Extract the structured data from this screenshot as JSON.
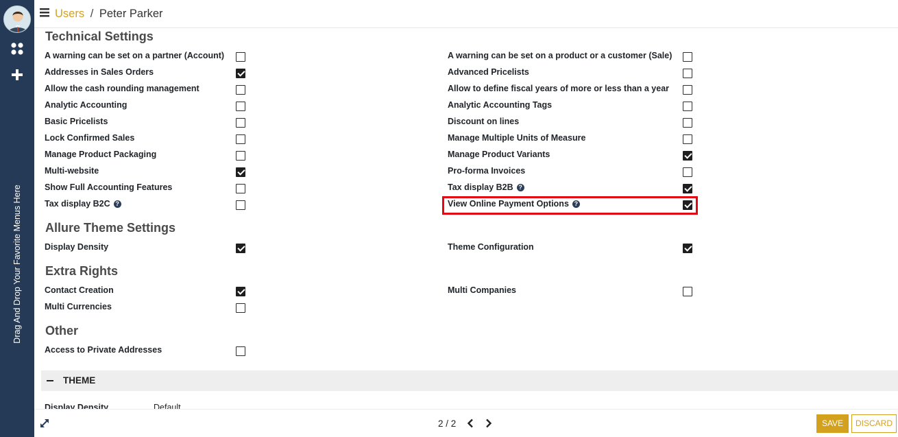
{
  "breadcrumb": {
    "parent": "Users",
    "separator": "/",
    "current": "Peter Parker"
  },
  "sidebar": {
    "favorite_hint": "Drag And Drop Your Favorite Menus Here"
  },
  "sections": {
    "technical": {
      "title": "Technical Settings",
      "left": [
        {
          "label": "A warning can be set on a partner (Account)",
          "checked": false
        },
        {
          "label": "Addresses in Sales Orders",
          "checked": true
        },
        {
          "label": "Allow the cash rounding management",
          "checked": false
        },
        {
          "label": "Analytic Accounting",
          "checked": false
        },
        {
          "label": "Basic Pricelists",
          "checked": false
        },
        {
          "label": "Lock Confirmed Sales",
          "checked": false
        },
        {
          "label": "Manage Product Packaging",
          "checked": false
        },
        {
          "label": "Multi-website",
          "checked": true
        },
        {
          "label": "Show Full Accounting Features",
          "checked": false
        },
        {
          "label": "Tax display B2C",
          "checked": false,
          "help": true
        }
      ],
      "right": [
        {
          "label": "A warning can be set on a product or a customer (Sale)",
          "checked": false
        },
        {
          "label": "Advanced Pricelists",
          "checked": false
        },
        {
          "label": "Allow to define fiscal years of more or less than a year",
          "checked": false
        },
        {
          "label": "Analytic Accounting Tags",
          "checked": false
        },
        {
          "label": "Discount on lines",
          "checked": false
        },
        {
          "label": "Manage Multiple Units of Measure",
          "checked": false
        },
        {
          "label": "Manage Product Variants",
          "checked": true
        },
        {
          "label": "Pro-forma Invoices",
          "checked": false
        },
        {
          "label": "Tax display B2B",
          "checked": true,
          "help": true
        },
        {
          "label": "View Online Payment Options",
          "checked": true,
          "help": true,
          "highlighted": true
        }
      ]
    },
    "allure": {
      "title": "Allure Theme Settings",
      "left": [
        {
          "label": "Display Density",
          "checked": true
        }
      ],
      "right": [
        {
          "label": "Theme Configuration",
          "checked": true
        }
      ]
    },
    "extra": {
      "title": "Extra Rights",
      "left": [
        {
          "label": "Contact Creation",
          "checked": true
        },
        {
          "label": "Multi Currencies",
          "checked": false
        }
      ],
      "right": [
        {
          "label": "Multi Companies",
          "checked": false
        }
      ]
    },
    "other": {
      "title": "Other",
      "left": [
        {
          "label": "Access to Private Addresses",
          "checked": false
        }
      ],
      "right": []
    }
  },
  "help_glyph": "?",
  "theme_panel": {
    "title": "THEME",
    "row_label": "Display Density",
    "row_value": "Default"
  },
  "footer": {
    "pager": "2 / 2",
    "save_label": "SAVE",
    "discard_label": "DISCARD"
  },
  "colors": {
    "accent": "#d4a11f",
    "sidebar": "#243a56",
    "highlight": "#e30613"
  }
}
